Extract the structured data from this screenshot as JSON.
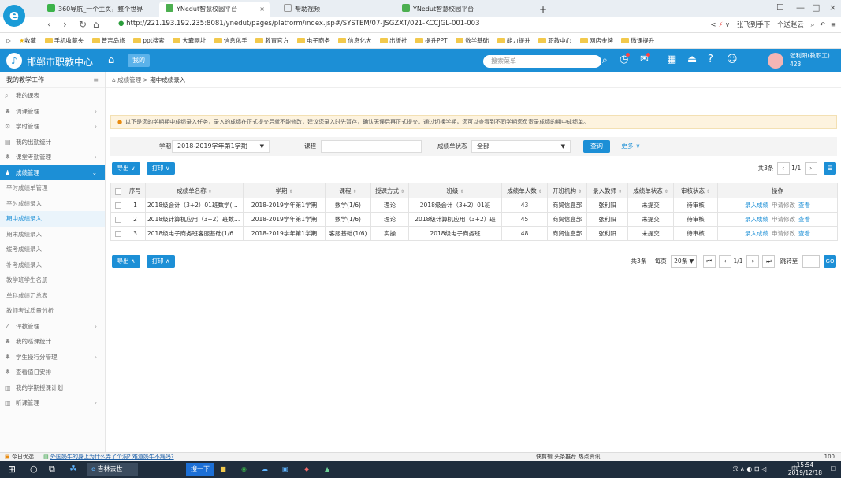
{
  "browser": {
    "tabs": [
      {
        "label": "360导航_一个主页，整个世界",
        "active": false
      },
      {
        "label": "YNedut智慧校园平台",
        "active": true
      },
      {
        "label": "帮助视频",
        "active": false
      },
      {
        "label": "YNedut智慧校园平台",
        "active": false
      }
    ],
    "new_tab": "+",
    "url_prefix": "http://",
    "url_host": "221.193.192.235",
    "url_path": ":8081/ynedut/pages/platform/index.jsp#/SYSTEM/07-JSGZXT/021-KCCJGL-001-003",
    "search_hint": "张飞到手下一个送赵云",
    "bookmarks": [
      "收藏",
      "手机收藏夹",
      "普吉岛旅",
      "ppt搜索",
      "大囊网址",
      "信息化手",
      "教育官方",
      "电子商务",
      "信息化大",
      "出版社",
      "提升PPT",
      "数学基础",
      "能力提升",
      "职教中心",
      "网店金牌",
      "微课提升"
    ]
  },
  "app": {
    "title": "邯郸市职教中心",
    "mine_label": "我的",
    "search_placeholder": "搜索菜单",
    "user_name": "张利阳(教职工)",
    "user_id": "423"
  },
  "sidebar": {
    "title": "我的教学工作",
    "items_top": [
      {
        "label": "我的课表",
        "arrow": ""
      },
      {
        "label": "调课管理",
        "arrow": "›"
      },
      {
        "label": "学时管理",
        "arrow": "›"
      },
      {
        "label": "我的出勤统计",
        "arrow": ""
      },
      {
        "label": "课堂考勤管理",
        "arrow": "›"
      }
    ],
    "active_item": "成绩管理",
    "sub_items": [
      "平时成绩单管理",
      "平时成绩录入",
      "期中成绩录入",
      "期末成绩录入",
      "缓考成绩录入",
      "补考成绩录入",
      "教学班学生名册",
      "单科成绩汇总表",
      "教师考试质量分析"
    ],
    "items_bottom": [
      {
        "label": "评教管理",
        "arrow": "›"
      },
      {
        "label": "我的巡课统计",
        "arrow": ""
      },
      {
        "label": "学生操行分管理",
        "arrow": "›"
      },
      {
        "label": "查看值日安排",
        "arrow": ""
      },
      {
        "label": "我的学期授课计划",
        "arrow": ""
      },
      {
        "label": "听课管理",
        "arrow": "›"
      }
    ]
  },
  "breadcrumb": {
    "parent": "成绩管理",
    "sep": ">",
    "current": "期中成绩录入"
  },
  "notice": "以下是您的学期期中成绩录入任务，录入的成绩在正式提交后就不能修改，建议您录入时先暂存，确认无误后再正式提交。通过切换学期，您可以查看到不同学期您负责录成绩的期中成绩单。",
  "filters": {
    "term_label": "学期",
    "term_value": "2018-2019学年第1学期",
    "course_label": "课程",
    "course_value": "",
    "status_label": "成绩单状态",
    "status_value": "全部",
    "query_button": "查询",
    "more_button": "更多 ∨"
  },
  "toolbar": {
    "export": "导出 ∨",
    "print": "打印 ∨",
    "export_bottom": "导出 ∧",
    "print_bottom": "打印 ∧"
  },
  "pager_top": {
    "total": "共3条",
    "page": "1/1"
  },
  "table": {
    "headers": [
      "序号",
      "成绩单名称",
      "学期",
      "课程",
      "授课方式",
      "班级",
      "成绩单人数",
      "开班机构",
      "录入教师",
      "成绩单状态",
      "审核状态",
      "操作"
    ],
    "rows": [
      {
        "no": "1",
        "name": "2018级会计（3+2）01班数学(1/6)...",
        "term": "2018-2019学年第1学期",
        "course": "数学(1/6)",
        "mode": "理论",
        "class": "2018级会计（3+2）01班",
        "count": "43",
        "org": "商贸信息部",
        "teacher": "张利阳",
        "status": "未提交",
        "audit": "待审核"
      },
      {
        "no": "2",
        "name": "2018级计算机应用（3+2）班数学(1...",
        "term": "2018-2019学年第1学期",
        "course": "数学(1/6)",
        "mode": "理论",
        "class": "2018级计算机应用（3+2）班",
        "count": "45",
        "org": "商贸信息部",
        "teacher": "张利阳",
        "status": "未提交",
        "audit": "待审核"
      },
      {
        "no": "3",
        "name": "2018级电子商务班客服基础(1/6)实...",
        "term": "2018-2019学年第1学期",
        "course": "客服基础(1/6)",
        "mode": "实操",
        "class": "2018级电子商务班",
        "count": "48",
        "org": "商贸信息部",
        "teacher": "张利阳",
        "status": "未提交",
        "audit": "待审核"
      }
    ],
    "actions": [
      "录入成绩",
      "申请修改",
      "查看"
    ]
  },
  "pager_bottom": {
    "total": "共3条",
    "per_page_label": "每页",
    "per_page": "20条",
    "page": "1/1",
    "jump_label": "跳转至",
    "go": "GO"
  },
  "statusbar": {
    "left": "今日优选",
    "news": "外国奶牛的身上为什么弄了个洞? 难道奶牛不痛吗?",
    "right": "快剪辑  头条推荐  热点资讯",
    "zoom": "100"
  },
  "taskbar": {
    "app": "吉林去世",
    "time": "15:54",
    "date": "2019/12/18",
    "ime": "中"
  }
}
